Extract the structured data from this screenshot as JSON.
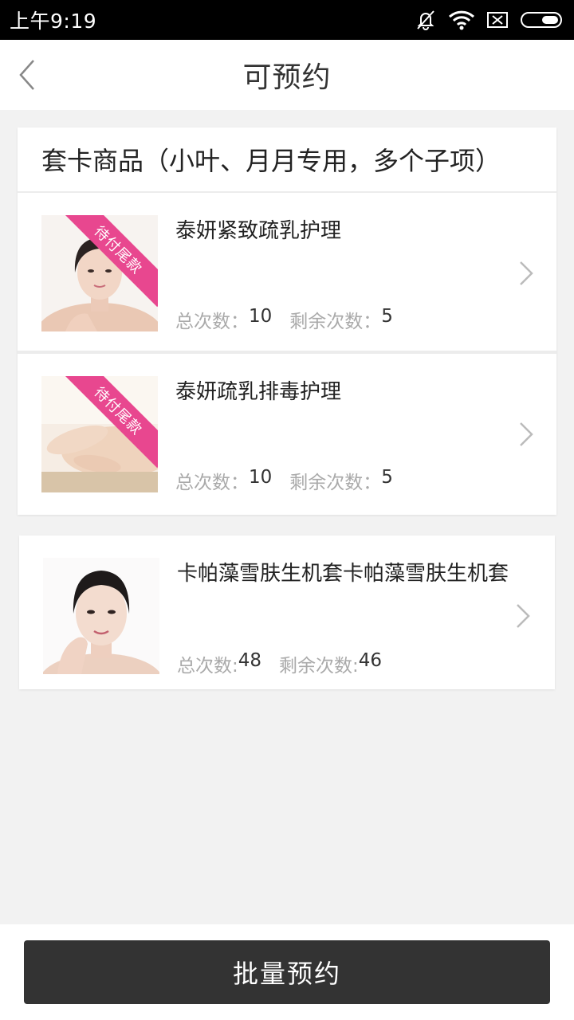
{
  "status_bar": {
    "time": "上午9:19",
    "icons": [
      "bell-off-icon",
      "wifi-icon",
      "sim-disabled-icon",
      "battery-icon"
    ]
  },
  "nav": {
    "title": "可预约",
    "back_icon": "chevron-left-icon"
  },
  "group": {
    "title": "套卡商品（小叶、月月专用，多个子项）",
    "items": [
      {
        "name": "泰妍紧致疏乳护理",
        "ribbon": "待付尾款",
        "total_label": "总次数：",
        "total_value": "10",
        "remaining_label": "剩余次数：",
        "remaining_value": "5"
      },
      {
        "name": "泰妍疏乳排毒护理",
        "ribbon": "待付尾款",
        "total_label": "总次数：",
        "total_value": "10",
        "remaining_label": "剩余次数：",
        "remaining_value": "5"
      }
    ]
  },
  "single": {
    "name": "卡帕藻雪肤生机套卡帕藻雪肤生机套",
    "total_label": "总次数:",
    "total_value": "48",
    "remaining_label": "剩余次数:",
    "remaining_value": "46"
  },
  "actions": {
    "batch_label": "批量预约"
  },
  "colors": {
    "ribbon": "#e8478f",
    "button_bg": "#333333",
    "page_bg": "#f2f2f2"
  }
}
